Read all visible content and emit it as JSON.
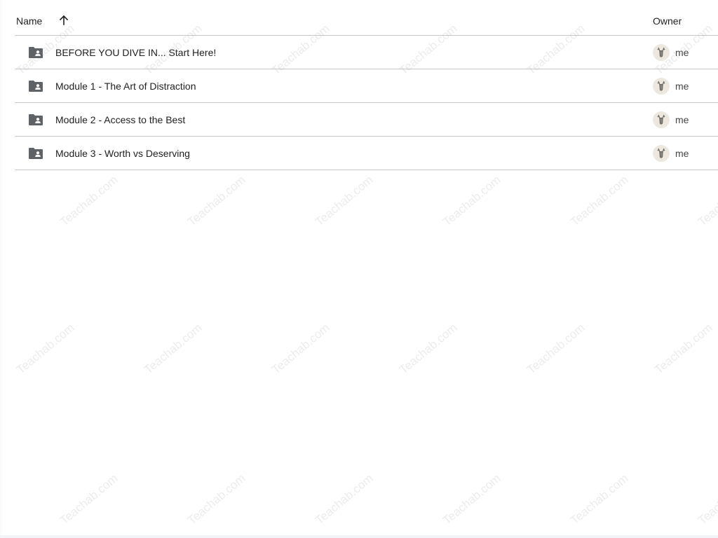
{
  "header": {
    "name_label": "Name",
    "owner_label": "Owner"
  },
  "rows": [
    {
      "name": "BEFORE YOU DIVE IN... Start Here!",
      "owner": "me",
      "icon": "shared-folder-icon"
    },
    {
      "name": "Module 1 - The Art of Distraction",
      "owner": "me",
      "icon": "shared-folder-icon"
    },
    {
      "name": "Module 2 - Access to the Best",
      "owner": "me",
      "icon": "shared-folder-icon"
    },
    {
      "name": "Module 3 - Worth vs Deserving",
      "owner": "me",
      "icon": "shared-folder-icon"
    }
  ],
  "watermark": "Teachab.com",
  "colors": {
    "folder": "#5f6368",
    "divider": "#c7c7c7",
    "text": "#1f1f1f"
  }
}
